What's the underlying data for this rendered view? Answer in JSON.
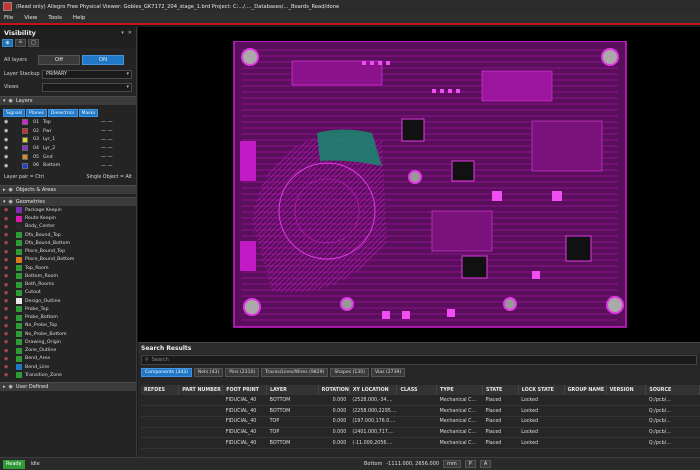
{
  "titlebar": {
    "title": "(Read only) Allegro Free Physical Viewer: Gobles_GK7172_204_stage_1.brd  Project: C:.../...._Databases/..._Boards_Read/done"
  },
  "menu": [
    "File",
    "View",
    "Tools",
    "Help"
  ],
  "visibility": {
    "title": "Visibility",
    "controls": [
      "▾",
      "✕"
    ],
    "all_layers_label": "All layers",
    "off_label": "Off",
    "on_label": "ON",
    "stackup_label": "Layer Stackup",
    "stackup_value": "PRIMARY",
    "views_label": "Views",
    "views_value": "",
    "layers_header": "Layers",
    "layer_tabs": [
      "Signals",
      "Planes",
      "Dielectrics",
      "Masks"
    ],
    "layers": [
      {
        "num": "01",
        "name": "Top",
        "color": "#e21be0"
      },
      {
        "num": "02",
        "name": "Pwr",
        "color": "#d62828"
      },
      {
        "num": "03",
        "name": "Lyr_1",
        "color": "#d9d926"
      },
      {
        "num": "04",
        "name": "Lyr_2",
        "color": "#8a2be2"
      },
      {
        "num": "05",
        "name": "Gnd",
        "color": "#d98c1e"
      },
      {
        "num": "06",
        "name": "Bottom",
        "color": "#1e3fd9"
      }
    ],
    "layer_pair_label": "Layer pair = Ctrl",
    "single_object_label": "Single Object = Alt",
    "objects_header": "Objects & Areas",
    "geometries_header": "Geometries",
    "geometries": [
      {
        "name": "Package Keepin",
        "color": "#7a2fb5"
      },
      {
        "name": "Route Keepin",
        "color": "#d81bb0"
      },
      {
        "name": "Body_Center",
        "color": "#2a2a2a"
      },
      {
        "name": "Dfa_Bound_Top",
        "color": "#2f9a36"
      },
      {
        "name": "Dfa_Bound_Bottom",
        "color": "#2f9a36"
      },
      {
        "name": "Place_Bound_Top",
        "color": "#2f9a36"
      },
      {
        "name": "Place_Bound_Bottom",
        "color": "#d97a1e"
      },
      {
        "name": "Top_Room",
        "color": "#2f9a36"
      },
      {
        "name": "Bottom_Room",
        "color": "#2f9a36"
      },
      {
        "name": "Both_Rooms",
        "color": "#2f9a36"
      },
      {
        "name": "Cutout",
        "color": "#2f9a36"
      },
      {
        "name": "Design_Outline",
        "color": "#e8e8e8"
      },
      {
        "name": "Probe_Top",
        "color": "#2f9a36"
      },
      {
        "name": "Probe_Bottom",
        "color": "#2f9a36"
      },
      {
        "name": "No_Probe_Top",
        "color": "#2f9a36"
      },
      {
        "name": "No_Probe_Bottom",
        "color": "#2f9a36"
      },
      {
        "name": "Drawing_Origin",
        "color": "#2f9a36"
      },
      {
        "name": "Zone_Outline",
        "color": "#2f9a36"
      },
      {
        "name": "Bend_Area",
        "color": "#2f9a36"
      },
      {
        "name": "Bend_Line",
        "color": "#1f78c8"
      },
      {
        "name": "Transition_Zone",
        "color": "#2f9a36"
      }
    ],
    "user_defined_header": "User Defined"
  },
  "search": {
    "title": "Search Results",
    "placeholder": "Search",
    "tabs": [
      "Components (343)",
      "Nets (43)",
      "Pins (2310)",
      "Traces/Lines/Wires (9829)",
      "Shapes (130)",
      "Vias (2739)"
    ],
    "columns": [
      "REFDES",
      "PART NUMBER",
      "FOOT PRINT",
      "LAYER",
      "ROTATION",
      "XY LOCATION",
      "CLASS",
      "TYPE",
      "STATE",
      "LOCK STATE",
      "GROUP NAME",
      "VERSION",
      "SOURCE"
    ],
    "rows": [
      [
        "",
        "",
        "FIDUCIAL_40",
        "BOTTOM",
        "0.000",
        "(2528.000,-34....",
        "",
        "Mechanical C...",
        "Placed",
        "Locked",
        "",
        "",
        "Q:/pcb/..."
      ],
      [
        "",
        "",
        "FIDUCIAL_40",
        "BOTTOM",
        "0.000",
        "(2258.000,2295....",
        "",
        "Mechanical C...",
        "Placed",
        "Locked",
        "",
        "",
        "Q:/pcb/..."
      ],
      [
        "",
        "",
        "FIDUCIAL_40",
        "TOP",
        "0.000",
        "(197.000,176.0....",
        "",
        "Mechanical C...",
        "Placed",
        "Locked",
        "",
        "",
        "Q:/pcb/..."
      ],
      [
        "",
        "",
        "FIDUCIAL_40",
        "TOP",
        "0.000",
        "(2401.000,717....",
        "",
        "Mechanical C...",
        "Placed",
        "Locked",
        "",
        "",
        "Q:/pcb/..."
      ],
      [
        "",
        "",
        "FIDUCIAL_40",
        "BOTTOM",
        "0.000",
        "(-11.000,2056....",
        "",
        "Mechanical C...",
        "Placed",
        "Locked",
        "",
        "",
        "Q:/pcb/..."
      ]
    ]
  },
  "status": {
    "ready": "Ready",
    "idle": "Idle",
    "layer": "Bottom",
    "coords": "-1111.000, 2656.000",
    "units": "mm",
    "p": "P",
    "a": "A"
  }
}
